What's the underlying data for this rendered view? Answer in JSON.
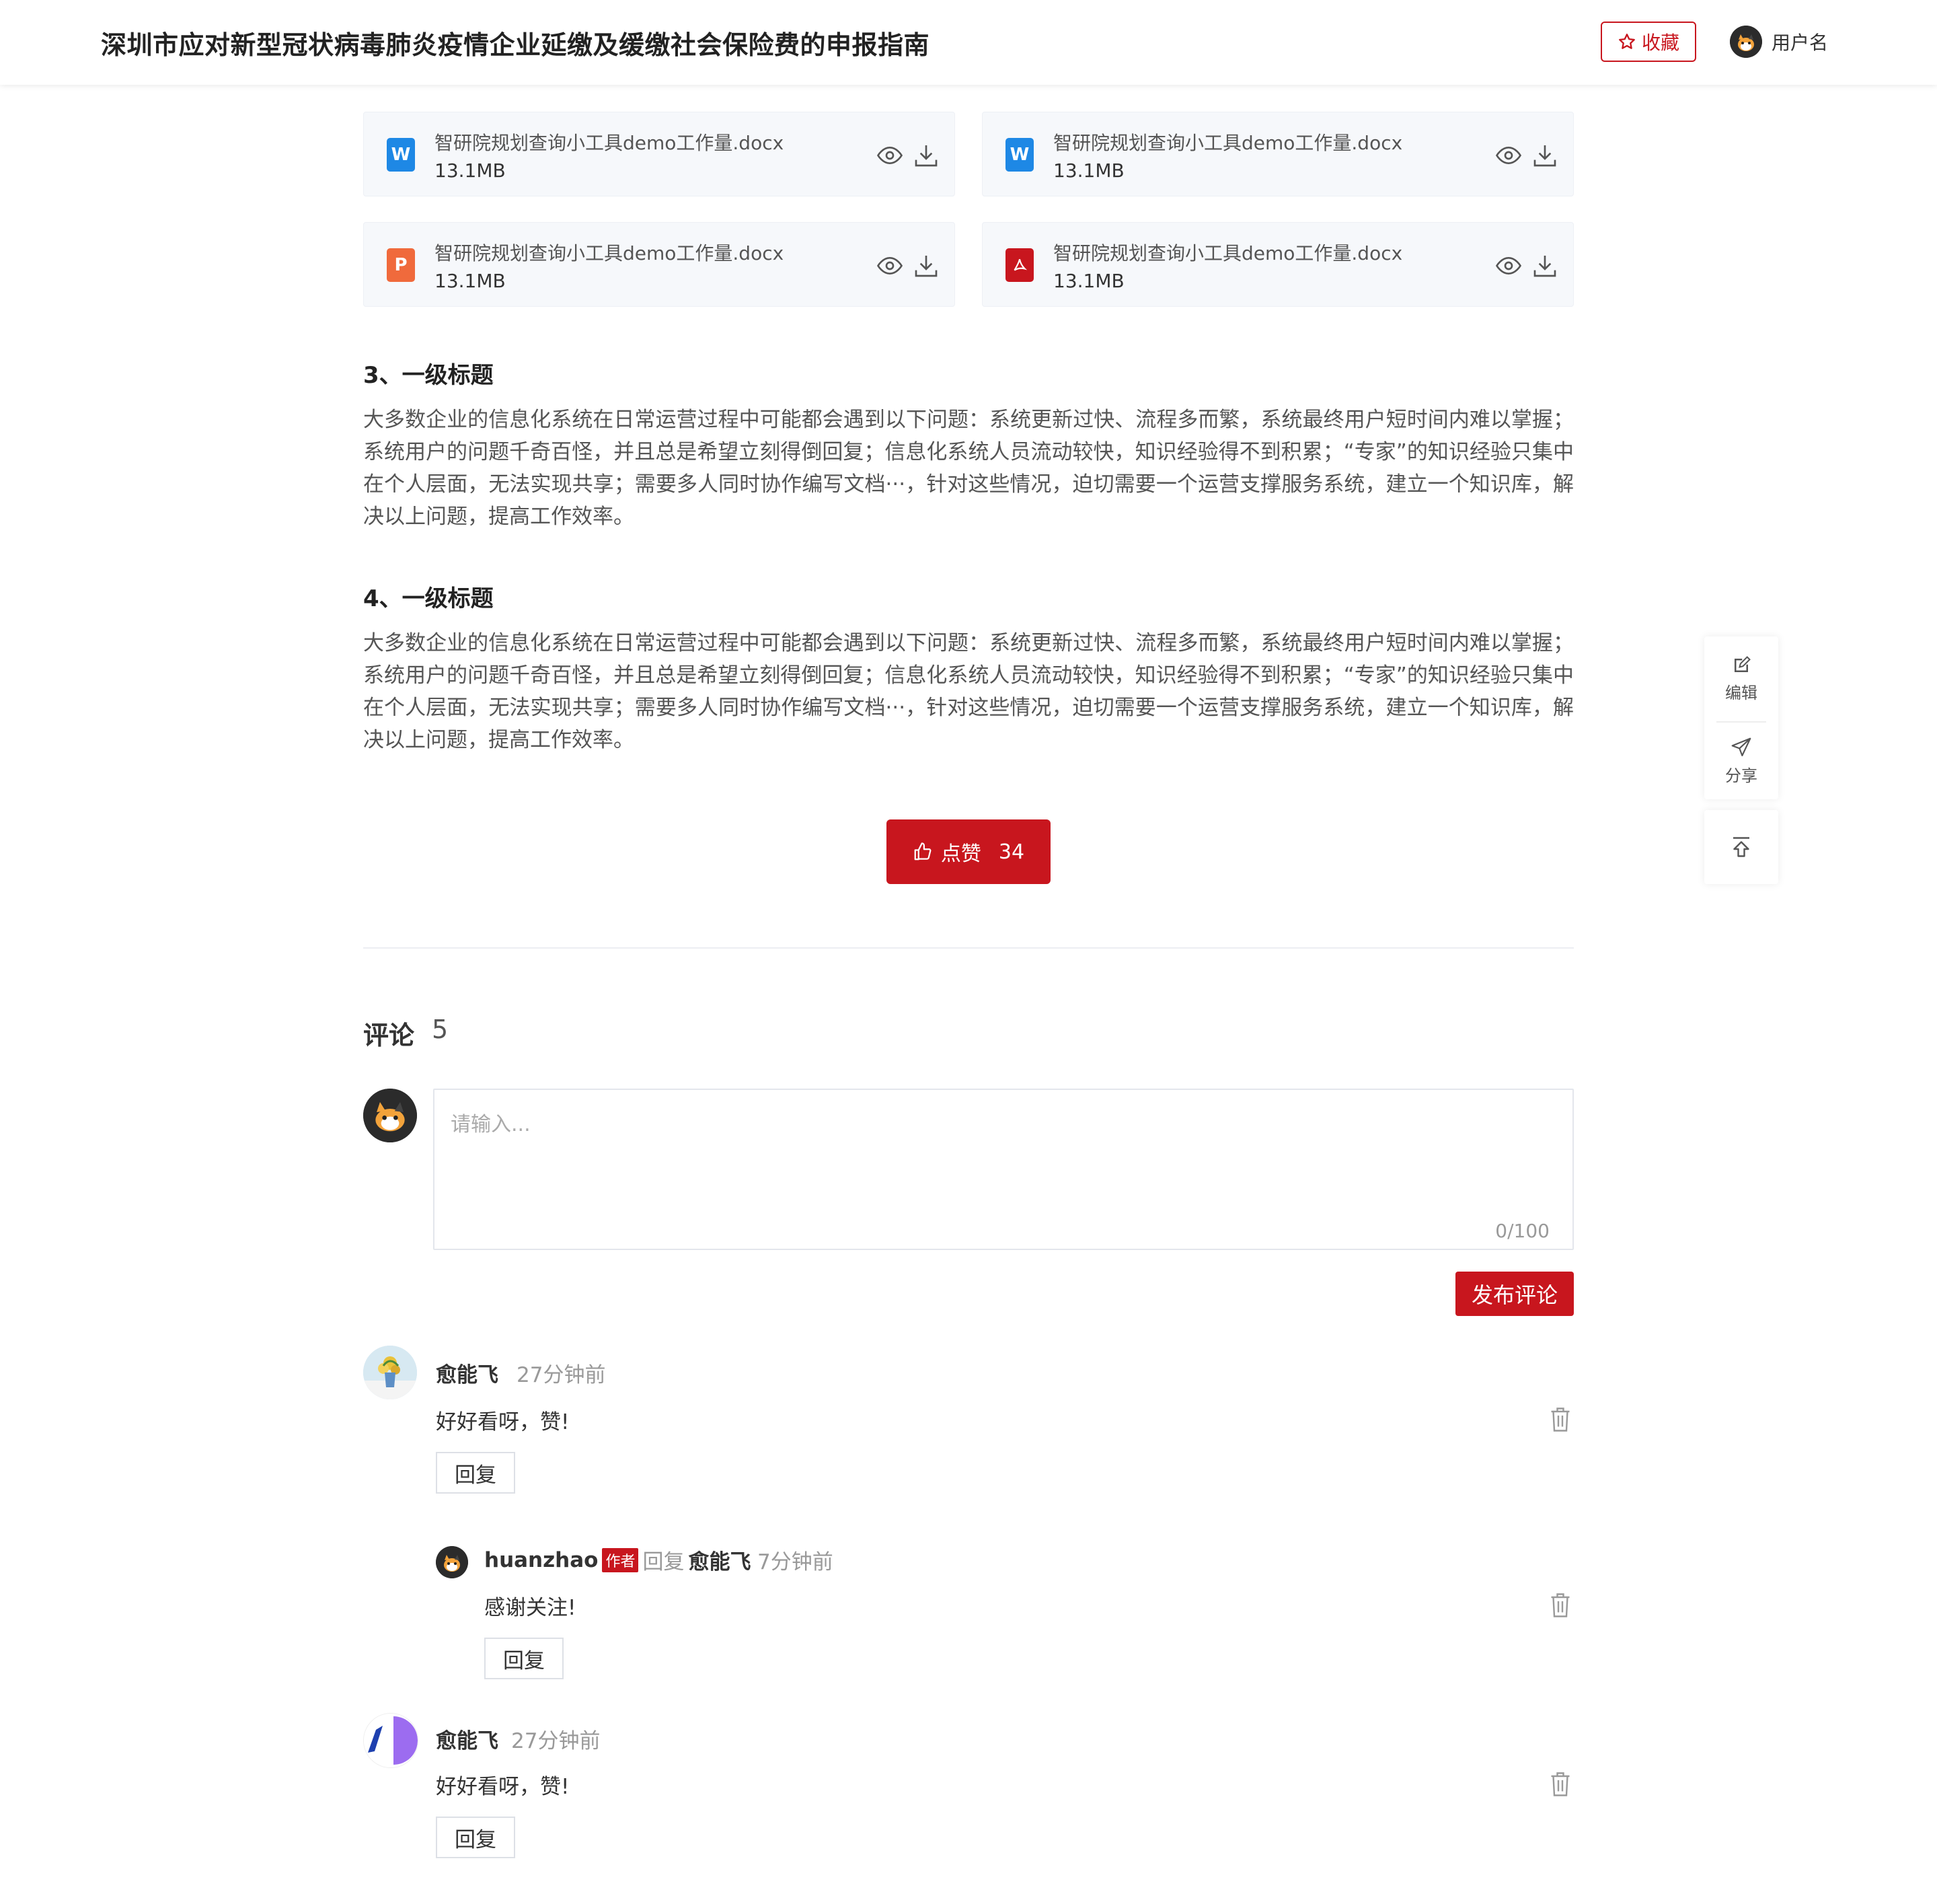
{
  "header": {
    "title": "深圳市应对新型冠状病毒肺炎疫情企业延缴及缓缴社会保险费的申报指南",
    "favorite_label": "收藏",
    "username": "用户名"
  },
  "files": [
    {
      "name": "智研院规划查询小工具demo工作量.docx",
      "size": "13.1MB",
      "type": "word",
      "icon_letter": "W",
      "color": "#1e88e5"
    },
    {
      "name": "智研院规划查询小工具demo工作量.docx",
      "size": "13.1MB",
      "type": "word",
      "icon_letter": "W",
      "color": "#1e88e5"
    },
    {
      "name": "智研院规划查询小工具demo工作量.docx",
      "size": "13.1MB",
      "type": "ppt",
      "icon_letter": "P",
      "color": "#f06a3c"
    },
    {
      "name": "智研院规划查询小工具demo工作量.docx",
      "size": "13.1MB",
      "type": "pdf",
      "icon_letter": "",
      "color": "#c8161e"
    }
  ],
  "sections": [
    {
      "title": "3、一级标题",
      "body": "大多数企业的信息化系统在日常运营过程中可能都会遇到以下问题：系统更新过快、流程多而繁，系统最终用户短时间内难以掌握；系统用户的问题千奇百怪，并且总是希望立刻得倒回复；信息化系统人员流动较快，知识经验得不到积累；“专家”的知识经验只集中在个人层面，无法实现共享；需要多人同时协作编写文档···，针对这些情况，迫切需要一个运营支撑服务系统，建立一个知识库，解决以上问题，提高工作效率。"
    },
    {
      "title": "4、一级标题",
      "body": "大多数企业的信息化系统在日常运营过程中可能都会遇到以下问题：系统更新过快、流程多而繁，系统最终用户短时间内难以掌握；系统用户的问题千奇百怪，并且总是希望立刻得倒回复；信息化系统人员流动较快，知识经验得不到积累；“专家”的知识经验只集中在个人层面，无法实现共享；需要多人同时协作编写文档···，针对这些情况，迫切需要一个运营支撑服务系统，建立一个知识库，解决以上问题，提高工作效率。"
    }
  ],
  "like": {
    "label": "点赞",
    "count": "34"
  },
  "comments_section": {
    "title": "评论",
    "count": "5",
    "placeholder": "请输入...",
    "counter": "0/100",
    "submit_label": "发布评论"
  },
  "comments": [
    {
      "author": "愈能飞",
      "time": "27分钟前",
      "text": "好好看呀，赞!",
      "reply_label": "回复"
    },
    {
      "author": "huanzhao",
      "badge": "作者",
      "reply_word": "回复",
      "reply_to": "愈能飞",
      "time": "7分钟前",
      "text": "感谢关注!",
      "reply_label": "回复"
    },
    {
      "author": "愈能飞",
      "time": "27分钟前",
      "text": "好好看呀，赞!",
      "reply_label": "回复"
    }
  ],
  "float_toolbar": {
    "edit_label": "编辑",
    "share_label": "分享"
  },
  "colors": {
    "accent": "#c8161e",
    "word": "#1e88e5",
    "ppt": "#f06a3c",
    "pdf": "#c8161e"
  },
  "icons": [
    "star-icon",
    "user-avatar-icon",
    "word-file-icon",
    "ppt-file-icon",
    "pdf-file-icon",
    "eye-icon",
    "download-icon",
    "thumbs-up-icon",
    "trash-icon",
    "edit-icon",
    "share-icon",
    "back-to-top-icon"
  ]
}
